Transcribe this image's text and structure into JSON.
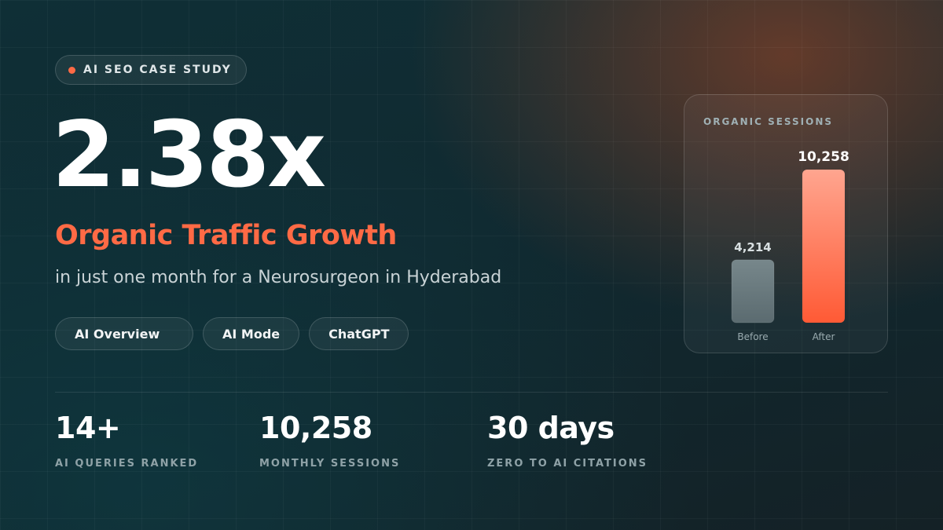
{
  "badge": {
    "label": "AI SEO CASE STUDY",
    "dot_color": "#ff6a45"
  },
  "hero": {
    "multiplier": "2.38x",
    "subtitle": "Organic Traffic Growth",
    "description": "in just one month for a Neurosurgeon in Hyderabad",
    "accent_color": "#ff6a45"
  },
  "pills": [
    {
      "label": "AI Overview"
    },
    {
      "label": "AI Mode"
    },
    {
      "label": "ChatGPT"
    }
  ],
  "chart_data": {
    "type": "bar",
    "title": "ORGANIC SESSIONS",
    "categories": [
      "Before",
      "After"
    ],
    "values": [
      4214,
      10258
    ],
    "value_labels": [
      "4,214",
      "10,258"
    ],
    "colors": [
      "#6b7b7f",
      "#ff6a45"
    ],
    "ylim": [
      0,
      10258
    ],
    "grid": false,
    "legend": "none"
  },
  "stats": [
    {
      "value": "14+",
      "label": "AI QUERIES RANKED"
    },
    {
      "value": "10,258",
      "label": "MONTHLY SESSIONS"
    },
    {
      "value": "30 days",
      "label": "ZERO TO AI CITATIONS"
    }
  ]
}
